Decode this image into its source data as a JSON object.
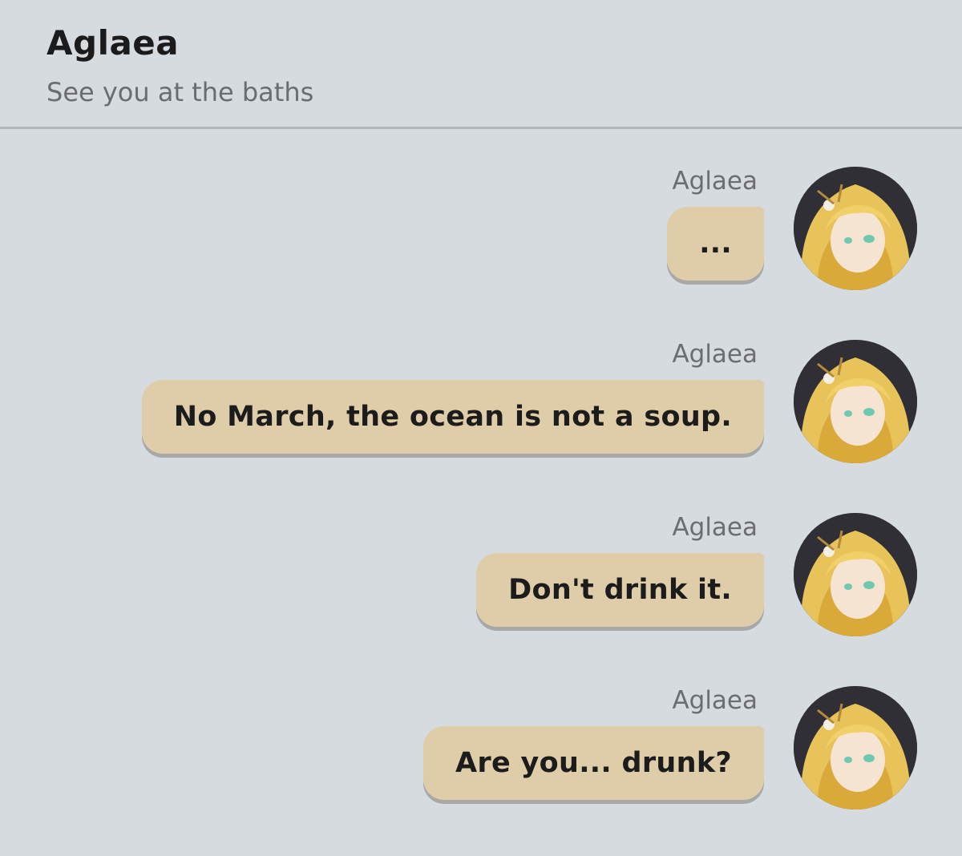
{
  "header": {
    "title": "Aglaea",
    "subtitle": "See you at the baths"
  },
  "messages": [
    {
      "sender": "Aglaea",
      "text": "..."
    },
    {
      "sender": "Aglaea",
      "text": "No March, the ocean is not a soup."
    },
    {
      "sender": "Aglaea",
      "text": "Don't drink it."
    },
    {
      "sender": "Aglaea",
      "text": "Are you... drunk?"
    }
  ],
  "colors": {
    "background": "#d6dbe0",
    "bubble": "#dfcca8",
    "divider": "#b3b6ba"
  }
}
